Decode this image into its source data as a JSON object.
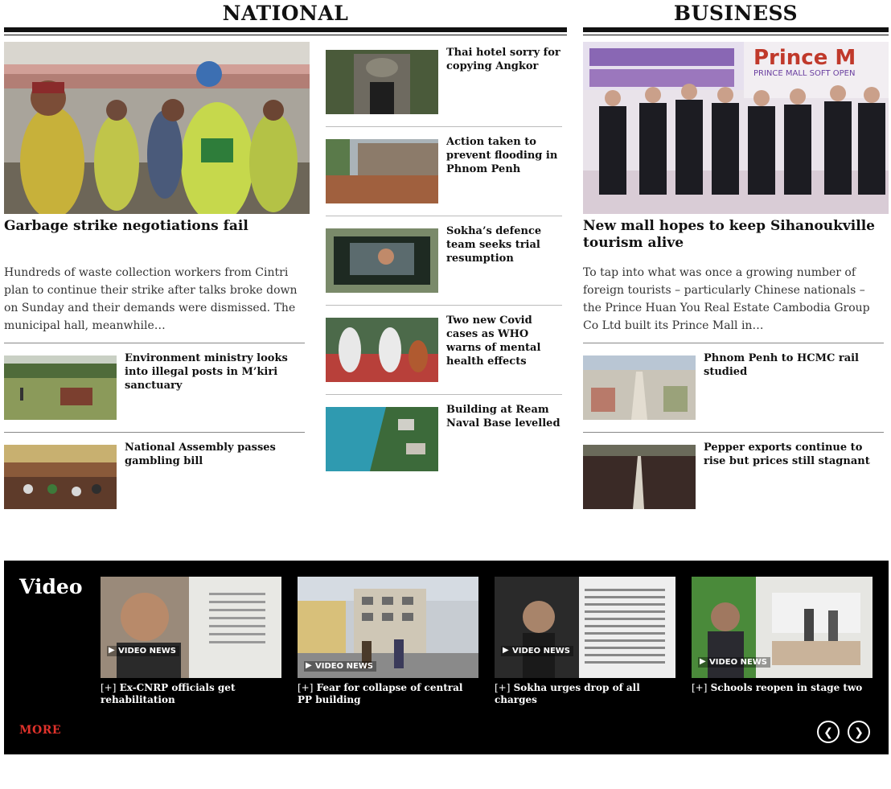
{
  "national": {
    "title": "NATIONAL",
    "lead": {
      "headline": "Garbage strike negotiations fail",
      "excerpt": "Hundreds of waste collection workers from Cintri plan to continue their strike after talks broke down on Sunday and their demands were dismissed. The municipal hall, meanwhile…"
    },
    "left_list": [
      {
        "headline": "Environment ministry looks into illegal posts in M’kiri sanctuary"
      },
      {
        "headline": "National Assembly passes gambling bill"
      }
    ],
    "right_list": [
      {
        "headline": "Thai hotel sorry for copying Angkor"
      },
      {
        "headline": "Action taken to prevent flooding in Phnom Penh"
      },
      {
        "headline": "Sokha’s defence team seeks trial resumption"
      },
      {
        "headline": "Two new Covid cases as WHO warns of mental health effects"
      },
      {
        "headline": "Building at Ream Naval Base levelled"
      }
    ]
  },
  "business": {
    "title": "BUSINESS",
    "lead": {
      "headline": "New mall hopes to keep Sihanoukville tourism alive",
      "excerpt": "To tap into what was once a growing number of foreign tourists – particularly Chinese nationals – the Prince Huan You Real Estate Cambodia Group Co Ltd built its Prince Mall in…",
      "banner_text": "PRINCE MALL SOFT OPEN",
      "banner_brand": "Prince M"
    },
    "list": [
      {
        "headline": "Phnom Penh to HCMC rail studied"
      },
      {
        "headline": "Pepper exports continue to rise but prices still stagnant"
      }
    ]
  },
  "video": {
    "title": "Video",
    "more_label": "MORE",
    "badge_label": "VIDEO NEWS",
    "plus_label": "[+]",
    "items": [
      {
        "caption": "Ex-CNRP officials get rehabilitation"
      },
      {
        "caption": "Fear for collapse of central PP building"
      },
      {
        "caption": "Sokha urges drop of all charges"
      },
      {
        "caption": "Schools reopen in stage two"
      }
    ],
    "prev_icon": "chevron-left-icon",
    "next_icon": "chevron-right-icon"
  },
  "colors": {
    "accent": "#e0322b",
    "video_bg": "#000000",
    "rule": "#111111"
  }
}
